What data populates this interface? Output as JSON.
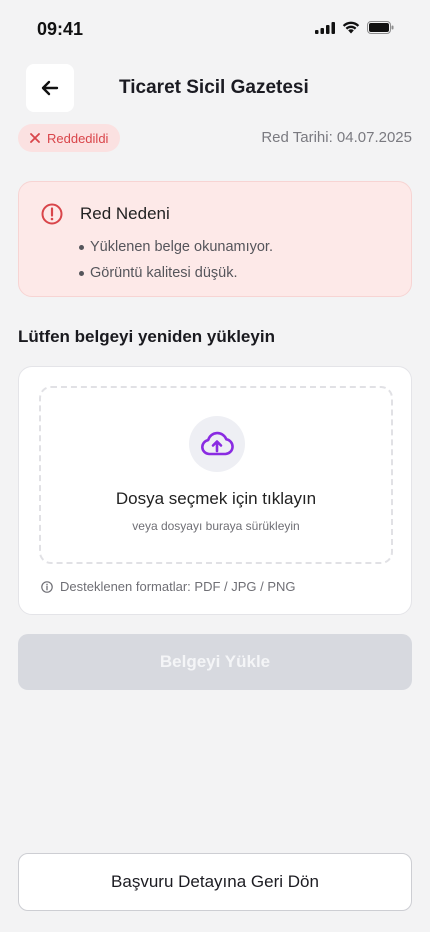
{
  "status_bar": {
    "time": "09:41",
    "icons": [
      "signal-icon",
      "wifi-icon",
      "battery-icon"
    ]
  },
  "header": {
    "back_icon": "arrow-left-icon",
    "title": "Ticaret Sicil Gazetesi"
  },
  "status": {
    "badge_label": "Reddedildi",
    "badge_icon": "close-icon",
    "reject_date": "Red Tarihi: 04.07.2025"
  },
  "rejection": {
    "title": "Red Nedeni",
    "icon": "alert-circle-icon",
    "reasons": [
      "Yüklenen belge okunamıyor.",
      "Görüntü kalitesi düşük."
    ]
  },
  "upload": {
    "section_title": "Lütfen belgeyi yeniden yükleyin",
    "icon": "cloud-upload-icon",
    "title": "Dosya seçmek için tıklayın",
    "subtitle": "veya dosyayı buraya sürükleyin",
    "formats_icon": "info-icon",
    "formats": "Desteklenen formatlar: PDF / JPG / PNG"
  },
  "actions": {
    "upload_label": "Belgeyi Yükle",
    "back_label": "Başvuru Detayına Geri Dön"
  },
  "colors": {
    "accent": "#8a2be2",
    "danger": "#d9454a",
    "danger_bg": "#fde9e8",
    "disabled_bg": "#d7d9df",
    "background": "#f3f3f4"
  }
}
